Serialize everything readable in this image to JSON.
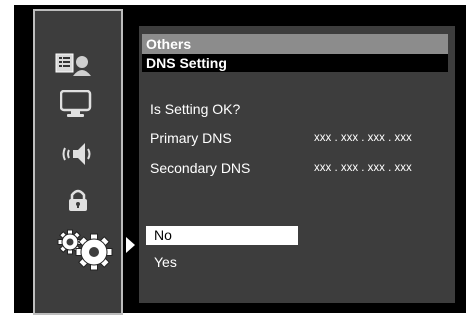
{
  "sidebar": {
    "items": [
      {
        "icon": "network-list-icon"
      },
      {
        "icon": "monitor-icon"
      },
      {
        "icon": "speaker-sound-icon"
      },
      {
        "icon": "lock-icon"
      },
      {
        "icon": "gears-icon",
        "selected": true
      }
    ]
  },
  "header": {
    "section": "Others",
    "title": "DNS Setting"
  },
  "main": {
    "question": "Is Setting OK?",
    "rows": [
      {
        "label": "Primary DNS",
        "value": "xxx . xxx . xxx . xxx"
      },
      {
        "label": "Secondary DNS",
        "value": "xxx . xxx . xxx . xxx"
      }
    ]
  },
  "options": {
    "no": "No",
    "yes": "Yes",
    "selected": "No"
  },
  "colors": {
    "panel": "#3d3d3d",
    "header_bar": "#8c8c8c",
    "selection": "#ffffff"
  }
}
